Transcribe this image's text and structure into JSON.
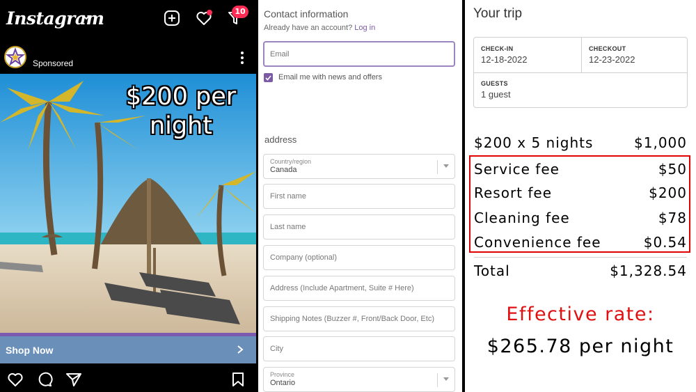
{
  "instagram": {
    "logo": "Instagram",
    "notification_count": "10",
    "post": {
      "account_label": "Sponsored",
      "price_overlay": "$200 per night",
      "shop_now": "Shop Now"
    },
    "icons": [
      "chevron-down-icon",
      "new-post-icon",
      "heart-icon",
      "filter-icon",
      "more-icon",
      "chevron-right-icon",
      "like-icon",
      "comment-icon",
      "share-icon",
      "bookmark-icon"
    ],
    "colors": {
      "badge": "#ff2d55",
      "shop_bar": "#6a8fb8",
      "shop_bar_accent": "#7a5bb0"
    }
  },
  "checkout": {
    "title": "Contact information",
    "have_account": "Already have an account?",
    "login_link": "Log in",
    "email_placeholder": "Email",
    "newsletter_label": "Email me with news and offers",
    "newsletter_checked": true,
    "address_heading": "address",
    "country": {
      "label": "Country/region",
      "value": "Canada"
    },
    "first_name_placeholder": "First name",
    "last_name_placeholder": "Last name",
    "company_placeholder": "Company (optional)",
    "address_placeholder": "Address (Include Apartment, Suite # Here)",
    "shipping_notes_placeholder": "Shipping Notes (Buzzer #, Front/Back Door, Etc)",
    "city_placeholder": "City",
    "province": {
      "label": "Province",
      "value": "Ontario"
    },
    "colors": {
      "accent": "#7b5ba6"
    }
  },
  "trip": {
    "title": "Your trip",
    "checkin_label": "CHECK-IN",
    "checkin_value": "12-18-2022",
    "checkout_label": "CHECKOUT",
    "checkout_value": "12-23-2022",
    "guests_label": "GUESTS",
    "guests_value": "1 guest",
    "base": {
      "label": "$200 x 5 nights",
      "amount": "$1,000"
    },
    "fees": [
      {
        "label": "Service fee",
        "amount": "$50"
      },
      {
        "label": "Resort fee",
        "amount": "$200"
      },
      {
        "label": "Cleaning fee",
        "amount": "$78"
      },
      {
        "label": "Convenience fee",
        "amount": "$0.54"
      }
    ],
    "total": {
      "label": "Total",
      "amount": "$1,328.54"
    },
    "effective_label": "Effective rate:",
    "effective_value": "$265.78 per night",
    "colors": {
      "highlight": "#e00000"
    }
  }
}
